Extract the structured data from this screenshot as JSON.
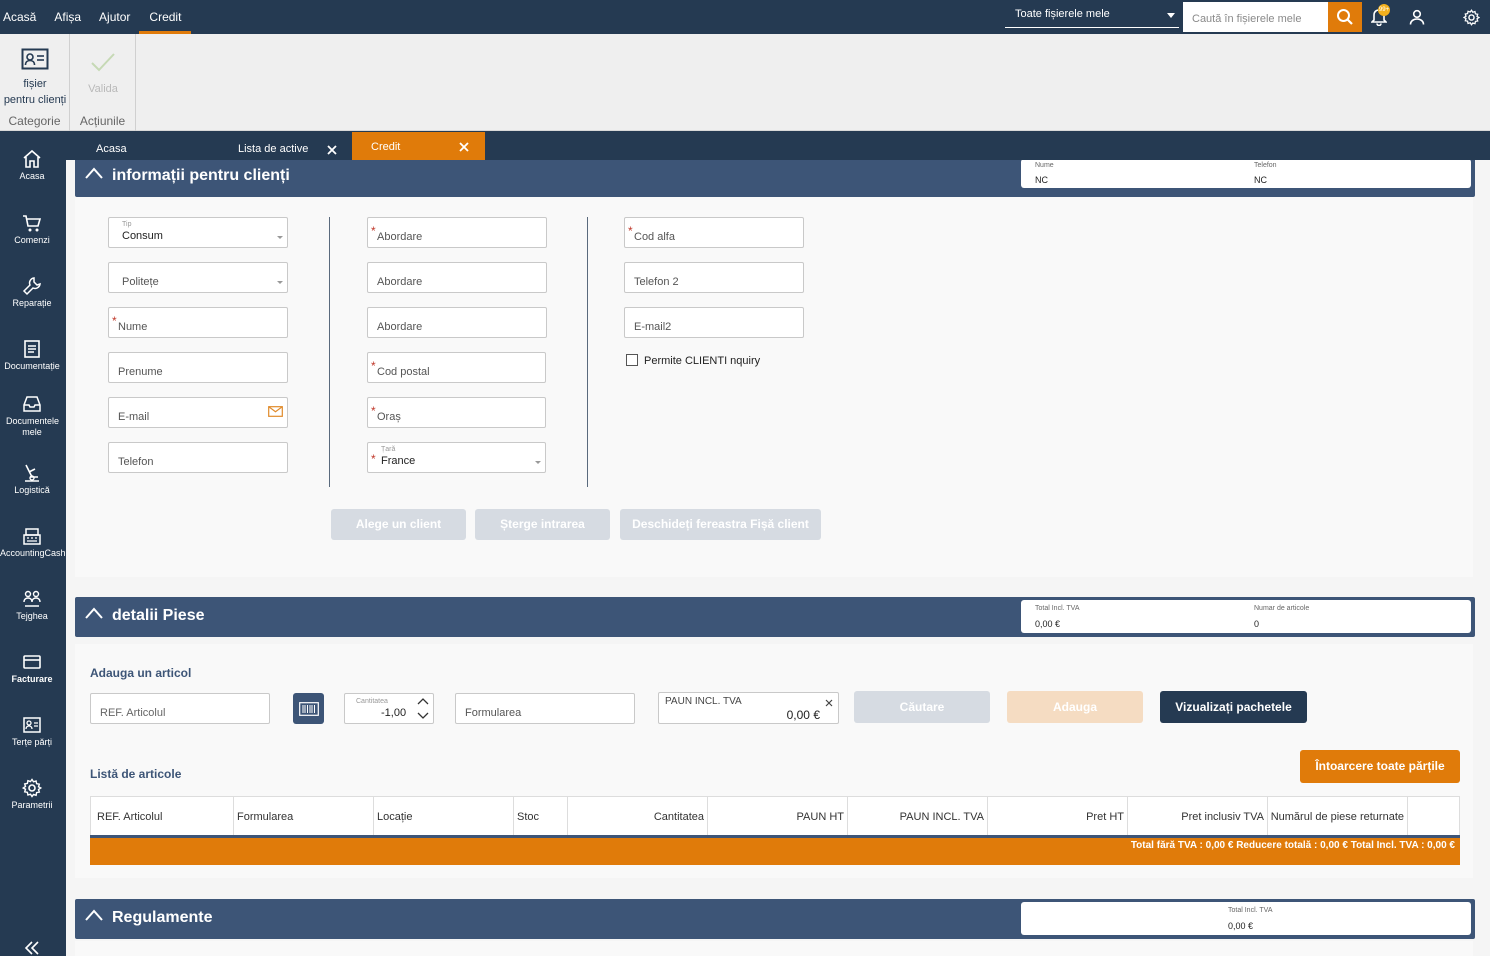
{
  "menu": [
    "Acasă",
    "Afișa",
    "Ajutor",
    "Credit"
  ],
  "header": {
    "file_select": "Toate fișierele mele",
    "search_placeholder": "Caută în fișierele mele",
    "badge": "99+"
  },
  "ribbon": {
    "client_btn_line1": "fișier",
    "client_btn_line2": "pentru clienți",
    "category_label": "Categorie",
    "validate_label": "Valida",
    "actions_label": "Acțiunile"
  },
  "tabs": {
    "home": "Acasa",
    "assets": "Lista de active",
    "credit": "Credit"
  },
  "sidebar": [
    {
      "label": "Acasa",
      "icon": "home-icon"
    },
    {
      "label": "Comenzi",
      "icon": "cart-icon"
    },
    {
      "label": "Reparație",
      "icon": "wrench-icon"
    },
    {
      "label": "Documentație",
      "icon": "document-icon"
    },
    {
      "label": "Documentele mele",
      "icon": "inbox-icon"
    },
    {
      "label": "Logistică",
      "icon": "logistics-icon"
    },
    {
      "label": "AccountingCash",
      "icon": "cash-register-icon"
    },
    {
      "label": "Tejghea",
      "icon": "people-icon"
    },
    {
      "label": "Facturare",
      "icon": "card-icon"
    },
    {
      "label": "Terțe părți",
      "icon": "contact-card-icon"
    },
    {
      "label": "Parametrii",
      "icon": "gear-icon"
    }
  ],
  "client_section": {
    "title": "informații pentru clienți",
    "name_label": "Nume",
    "name_value": "NC",
    "phone_label": "Telefon",
    "phone_value": "NC",
    "type_label": "Tip",
    "type_value": "Consum",
    "politeness": "Politețe",
    "last_name": "Nume",
    "first_name": "Prenume",
    "email": "E-mail",
    "phone": "Telefon",
    "address1": "Abordare",
    "address2": "Abordare",
    "address3": "Abordare",
    "postal_code": "Cod postal",
    "city": "Oraș",
    "country_label": "Țară",
    "country_value": "France",
    "alpha_code": "Cod alfa",
    "phone2": "Telefon 2",
    "email2": "E-mail2",
    "allow_inquiry": "Permite CLIENTI nquiry",
    "btn_choose": "Alege un client",
    "btn_delete": "Șterge intrarea",
    "btn_open": "Deschideți fereastra Fișă client"
  },
  "parts_section": {
    "title": "detalii Piese",
    "total_label": "Total Incl. TVA",
    "total_value": "0,00 €",
    "count_label": "Numar de articole",
    "count_value": "0",
    "add_article": "Adauga un articol",
    "ref_placeholder": "REF. Articolul",
    "qty_label": "Cantitatea",
    "qty_value": "-1,00",
    "wording_placeholder": "Formularea",
    "price_label": "PAUN INCL. TVA",
    "price_value": "0,00 €",
    "btn_search": "Căutare",
    "btn_add": "Adauga",
    "btn_packages": "Vizualizați pachetele",
    "list_title": "Listă de articole",
    "btn_return_all": "Întoarcere toate părțile",
    "columns": [
      "REF. Articolul",
      "Formularea",
      "Locație",
      "Stoc",
      "Cantitatea",
      "PAUN HT",
      "PAUN INCL. TVA",
      "Pret HT",
      "Pret inclusiv TVA",
      "Numărul de piese returnate"
    ],
    "footer": "Total fără TVA : 0,00 €     Reducere totală : 0,00 €     Total Incl. TVA : 0,00 €"
  },
  "rules_section": {
    "title": "Regulamente",
    "total_label": "Total Incl. TVA",
    "total_value": "0,00 €"
  },
  "colors": {
    "accent": "#e07b0a",
    "navy": "#253a52",
    "section": "#3d5577"
  }
}
